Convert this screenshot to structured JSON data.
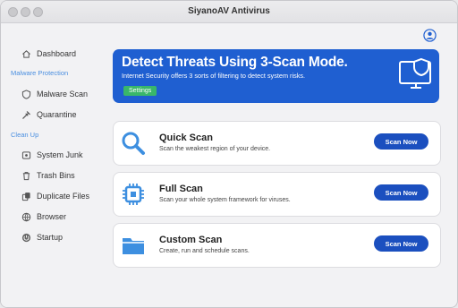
{
  "window": {
    "title": "SiyanoAV Antivirus"
  },
  "sidebar": {
    "dashboard": "Dashboard",
    "section_malware": "Malware Protection",
    "malware_scan": "Malware Scan",
    "quarantine": "Quarantine",
    "section_cleanup": "Clean Up",
    "system_junk": "System Junk",
    "trash_bins": "Trash Bins",
    "duplicate_files": "Duplicate Files",
    "browser": "Browser",
    "startup": "Startup"
  },
  "banner": {
    "title": "Detect Threats Using 3-Scan Mode.",
    "subtitle": "Internet Security offers 3 sorts of filtering to detect system risks.",
    "settings_label": "Settings"
  },
  "scans": {
    "quick": {
      "title": "Quick Scan",
      "desc": "Scan the weakest region of your device.",
      "button": "Scan Now"
    },
    "full": {
      "title": "Full Scan",
      "desc": "Scan your whole system framework for viruses.",
      "button": "Scan Now"
    },
    "custom": {
      "title": "Custom Scan",
      "desc": "Create, run and schedule scans.",
      "button": "Scan Now"
    }
  },
  "colors": {
    "accent": "#1f5fd1",
    "button": "#1b4fbf",
    "settings": "#39b76a",
    "section_label": "#4a8fe0",
    "icon": "#3d8fe0"
  }
}
